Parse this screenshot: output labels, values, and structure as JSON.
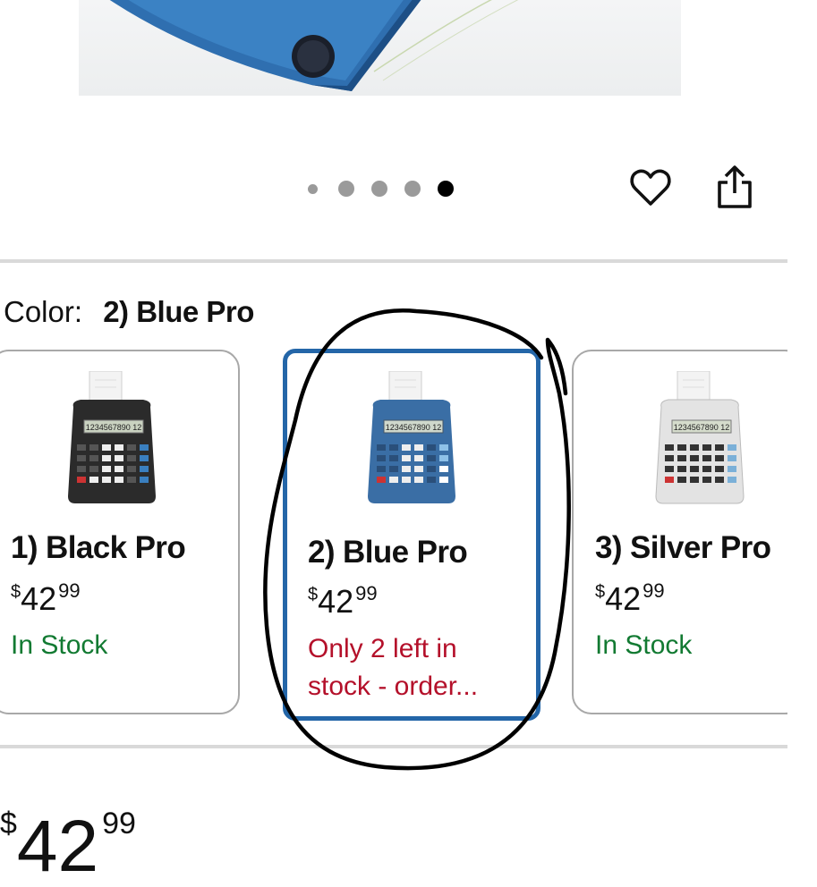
{
  "gallery": {
    "active_index": 4,
    "total": 5
  },
  "actions": {
    "wishlist_icon": "heart-icon",
    "share_icon": "share-icon"
  },
  "color_selector": {
    "label": "Color:",
    "selected": "2) Blue Pro"
  },
  "variants": [
    {
      "name": "1) Black Pro",
      "currency": "$",
      "price_whole": "42",
      "price_cents": "99",
      "stock": "In Stock",
      "stock_status": "in-stock",
      "body_color": "#2b2b2b",
      "selected": false
    },
    {
      "name": "2) Blue Pro",
      "currency": "$",
      "price_whole": "42",
      "price_cents": "99",
      "stock": "Only 2 left in stock - order...",
      "stock_status": "low-stock",
      "body_color": "#3a6ea5",
      "selected": true
    },
    {
      "name": "3) Silver Pro",
      "currency": "$",
      "price_whole": "42",
      "price_cents": "99",
      "stock": "In Stock",
      "stock_status": "in-stock",
      "body_color": "#d9d9d9",
      "selected": false
    }
  ],
  "main_price": {
    "currency": "$",
    "whole": "42",
    "cents": "99"
  },
  "colors": {
    "accent_blue": "#2466a8",
    "in_stock_green": "#127a32",
    "low_stock_red": "#b4102a"
  }
}
